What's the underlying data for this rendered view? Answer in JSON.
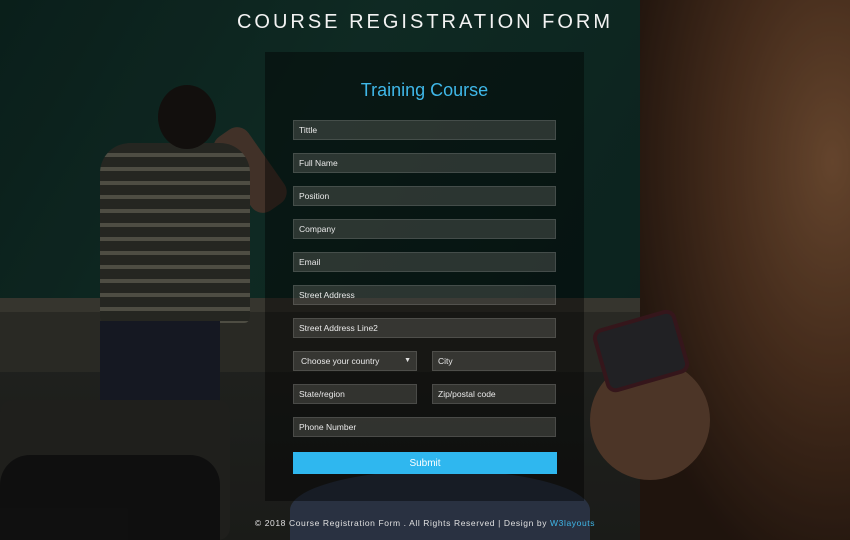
{
  "page": {
    "title": "COURSE REGISTRATION FORM"
  },
  "form": {
    "heading": "Training Course",
    "fields": {
      "tittle": "Tittle",
      "full_name": "Full Name",
      "position": "Position",
      "company": "Company",
      "email": "Email",
      "street_address": "Street Address",
      "street_address_2": "Street Address Line2",
      "country": "Choose your country",
      "city": "City",
      "state": "State/region",
      "zip": "Zip/postal code",
      "phone": "Phone Number"
    },
    "submit_label": "Submit"
  },
  "footer": {
    "text": "© 2018 Course Registration Form . All Rights Reserved | Design by ",
    "link": "W3layouts"
  },
  "colors": {
    "accent": "#2fb7ef",
    "heading": "#3fb7e8"
  }
}
